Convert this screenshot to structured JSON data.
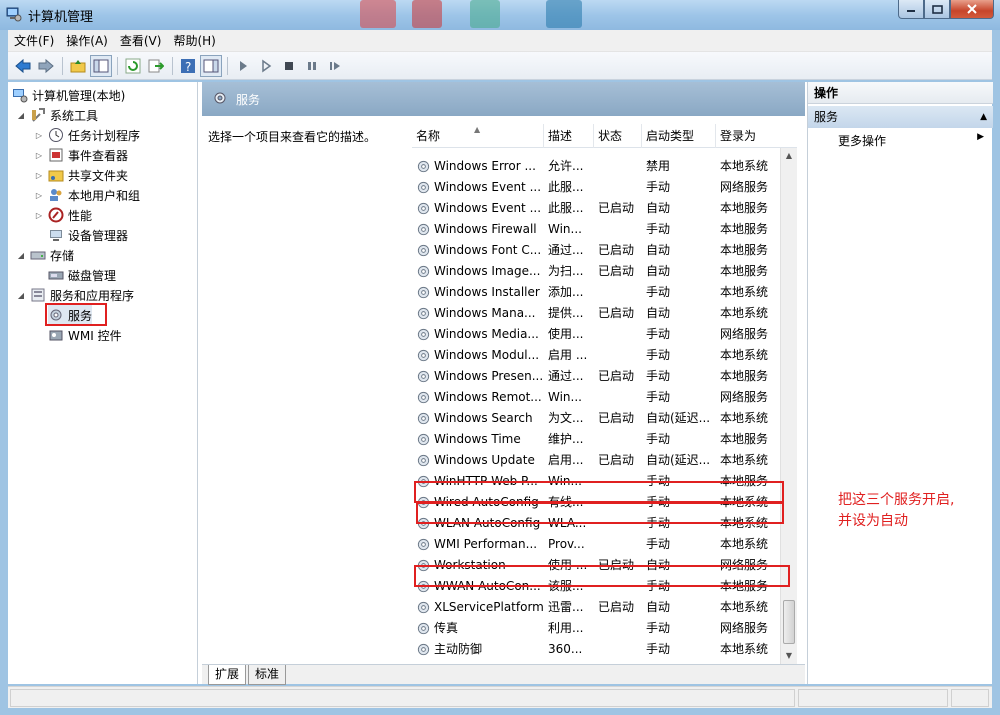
{
  "window": {
    "title": "计算机管理"
  },
  "menu": [
    "文件(F)",
    "操作(A)",
    "查看(V)",
    "帮助(H)"
  ],
  "toolbar_icons": [
    "back-arrow-icon",
    "forward-arrow-icon",
    "up-folder-icon",
    "show-hide-tree-icon",
    "refresh-icon",
    "export-icon",
    "help-icon",
    "properties-icon",
    "play-icon",
    "play-alt-icon",
    "stop-icon",
    "pause-icon",
    "restart-icon"
  ],
  "tree": {
    "root": "计算机管理(本地)",
    "system_tools": "系统工具",
    "task_scheduler": "任务计划程序",
    "event_viewer": "事件查看器",
    "shared_folders": "共享文件夹",
    "local_users": "本地用户和组",
    "performance": "性能",
    "device_manager": "设备管理器",
    "storage": "存储",
    "disk_management": "磁盘管理",
    "services_apps": "服务和应用程序",
    "services": "服务",
    "wmi": "WMI 控件"
  },
  "center": {
    "header_title": "服务",
    "description_hint": "选择一个项目来查看它的描述。",
    "columns": {
      "name": "名称",
      "desc": "描述",
      "status": "状态",
      "startup": "启动类型",
      "logon": "登录为"
    },
    "rows": [
      {
        "name": "Windows Error ...",
        "desc": "允许...",
        "status": "",
        "startup": "禁用",
        "logon": "本地系统"
      },
      {
        "name": "Windows Event ...",
        "desc": "此服...",
        "status": "",
        "startup": "手动",
        "logon": "网络服务"
      },
      {
        "name": "Windows Event ...",
        "desc": "此服...",
        "status": "已启动",
        "startup": "自动",
        "logon": "本地服务"
      },
      {
        "name": "Windows Firewall",
        "desc": "Win...",
        "status": "",
        "startup": "手动",
        "logon": "本地服务"
      },
      {
        "name": "Windows Font C...",
        "desc": "通过...",
        "status": "已启动",
        "startup": "自动",
        "logon": "本地服务"
      },
      {
        "name": "Windows Image...",
        "desc": "为扫...",
        "status": "已启动",
        "startup": "自动",
        "logon": "本地服务"
      },
      {
        "name": "Windows Installer",
        "desc": "添加...",
        "status": "",
        "startup": "手动",
        "logon": "本地系统"
      },
      {
        "name": "Windows Mana...",
        "desc": "提供...",
        "status": "已启动",
        "startup": "自动",
        "logon": "本地系统"
      },
      {
        "name": "Windows Media...",
        "desc": "使用...",
        "status": "",
        "startup": "手动",
        "logon": "网络服务"
      },
      {
        "name": "Windows Modul...",
        "desc": "启用 ...",
        "status": "",
        "startup": "手动",
        "logon": "本地系统"
      },
      {
        "name": "Windows Presen...",
        "desc": "通过...",
        "status": "已启动",
        "startup": "手动",
        "logon": "本地服务"
      },
      {
        "name": "Windows Remot...",
        "desc": "Win...",
        "status": "",
        "startup": "手动",
        "logon": "网络服务"
      },
      {
        "name": "Windows Search",
        "desc": "为文...",
        "status": "已启动",
        "startup": "自动(延迟...",
        "logon": "本地系统"
      },
      {
        "name": "Windows Time",
        "desc": "维护...",
        "status": "",
        "startup": "手动",
        "logon": "本地服务"
      },
      {
        "name": "Windows Update",
        "desc": "启用...",
        "status": "已启动",
        "startup": "自动(延迟...",
        "logon": "本地系统"
      },
      {
        "name": "WinHTTP Web P...",
        "desc": "Win...",
        "status": "",
        "startup": "手动",
        "logon": "本地服务"
      },
      {
        "name": "Wired AutoConfig",
        "desc": "有线...",
        "status": "",
        "startup": "手动",
        "logon": "本地系统"
      },
      {
        "name": "WLAN AutoConfig",
        "desc": "WLA...",
        "status": "",
        "startup": "手动",
        "logon": "本地系统"
      },
      {
        "name": "WMI Performan...",
        "desc": "Prov...",
        "status": "",
        "startup": "手动",
        "logon": "本地系统"
      },
      {
        "name": "Workstation",
        "desc": "使用 ...",
        "status": "已启动",
        "startup": "自动",
        "logon": "网络服务"
      },
      {
        "name": "WWAN AutoCon...",
        "desc": "该服...",
        "status": "",
        "startup": "手动",
        "logon": "本地服务"
      },
      {
        "name": "XLServicePlatform",
        "desc": "迅雷...",
        "status": "已启动",
        "startup": "自动",
        "logon": "本地系统"
      },
      {
        "name": "传真",
        "desc": "利用...",
        "status": "",
        "startup": "手动",
        "logon": "网络服务"
      },
      {
        "name": "主动防御",
        "desc": "360...",
        "status": "",
        "startup": "手动",
        "logon": "本地系统"
      }
    ],
    "tabs": [
      "扩展",
      "标准"
    ]
  },
  "actions": {
    "title": "操作",
    "section": "服务",
    "more": "更多操作"
  },
  "annotation": {
    "line1": "把这三个服务开启,",
    "line2": "并设为自动"
  },
  "colors": {
    "highlight": "#e02020",
    "header": "#8aa8c4"
  }
}
